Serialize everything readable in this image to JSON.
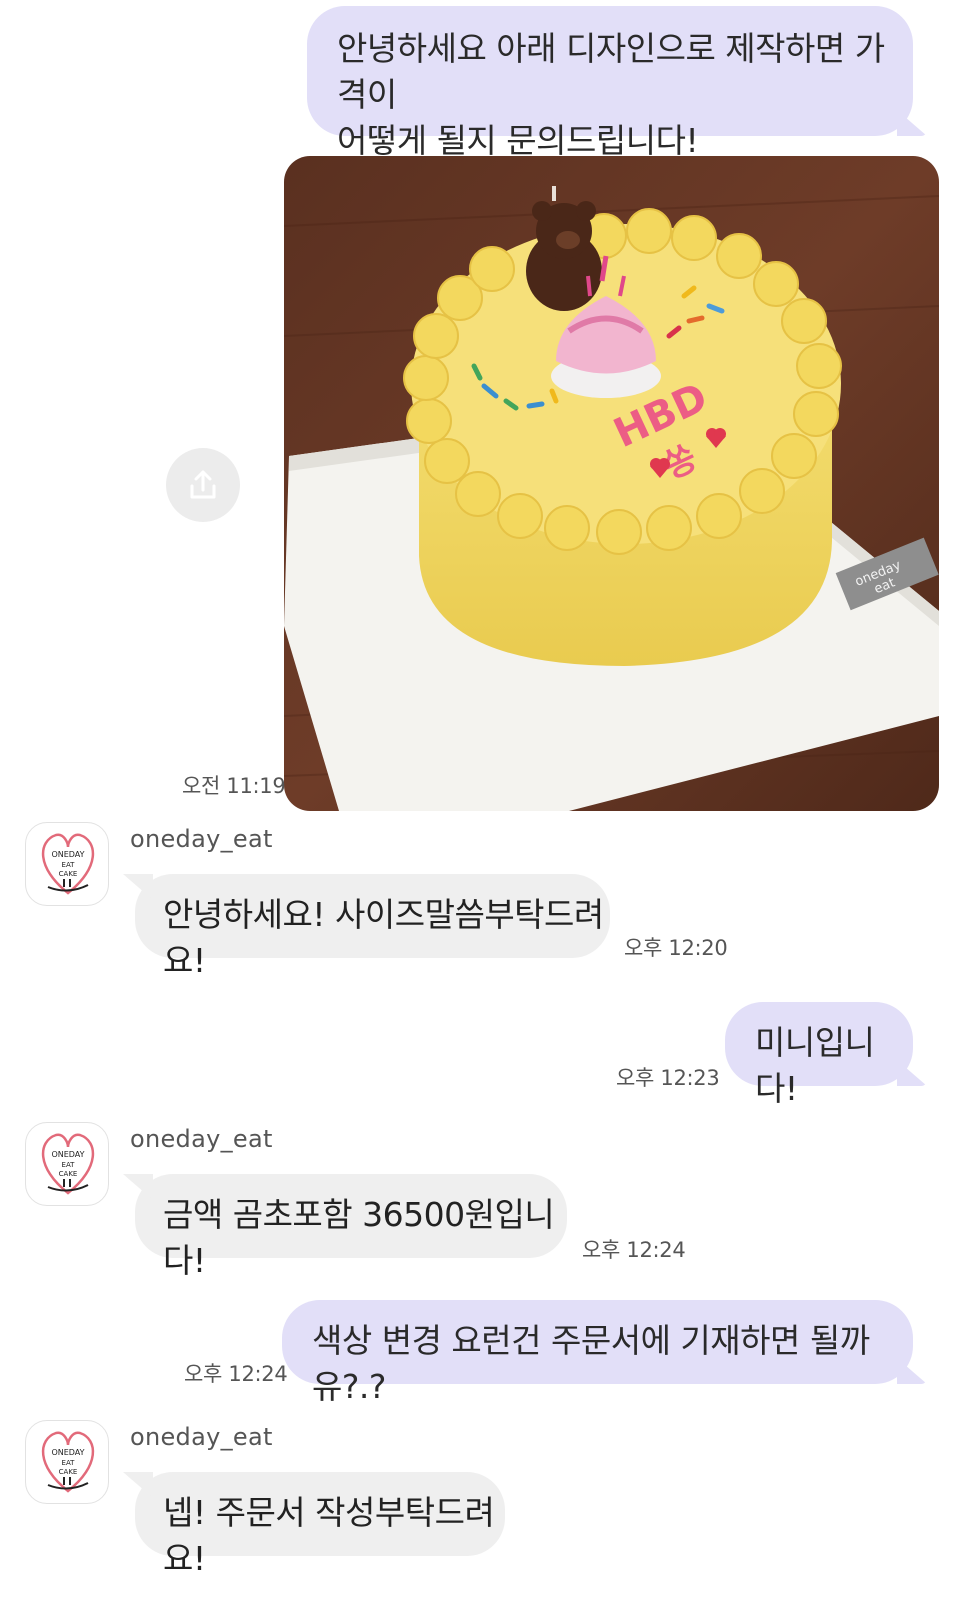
{
  "messages": [
    {
      "text_line1": "안녕하세요 아래 디자인으로 제작하면 가격이",
      "text_line2": "어떻게 될지 문의드립니다!"
    },
    {
      "time": "오전 11:19"
    },
    {
      "sender": "oneday_eat",
      "text": "안녕하세요! 사이즈말씀부탁드려요!",
      "time": "오후 12:20"
    },
    {
      "text": "미니입니다!",
      "time": "오후 12:23"
    },
    {
      "sender": "oneday_eat",
      "text": "금액 곰초포함 36500원입니다!",
      "time": "오후 12:24"
    },
    {
      "text": "색상 변경 요런건 주문서에 기재하면 될까유?.?",
      "time": "오후 12:24"
    },
    {
      "sender": "oneday_eat",
      "text": "넵! 주문서 작성부탁드려요!"
    }
  ],
  "photo": {
    "cake_text": "HBD",
    "cake_text2": "쏭",
    "board_label_line1": "oneday",
    "board_label_line2": "eat"
  },
  "avatar": {
    "line1": "ONEDAY",
    "line2": "EAT",
    "line3": "CAKE"
  },
  "icons": {
    "share": "share-icon",
    "avatar": "oneday-eat-logo"
  },
  "colors": {
    "outgoing_bubble": "#e2dff8",
    "incoming_bubble": "#efefef"
  }
}
